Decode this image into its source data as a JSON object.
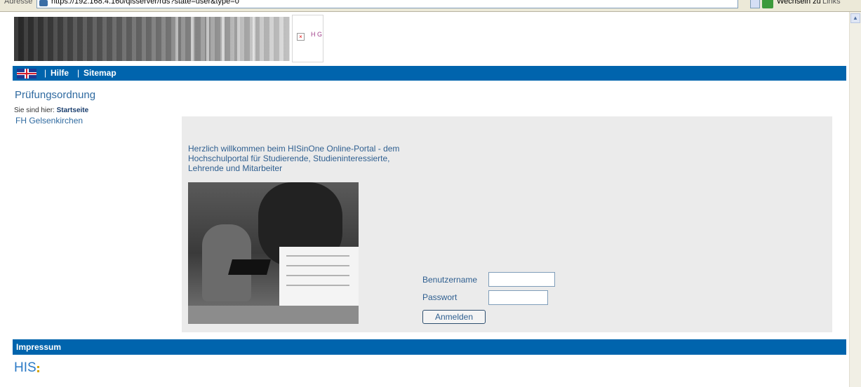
{
  "browser": {
    "address_label": "Adresse",
    "url": "https://192.168.4.160/qisserver/rds?state=user&type=0",
    "go_label": "Wechseln zu",
    "links_label": "Links"
  },
  "header": {
    "logo_alt": "H G",
    "nav": {
      "help_label": "Hilfe",
      "sitemap_label": "Sitemap",
      "separator": "|"
    }
  },
  "page": {
    "title": "Prüfungsordnung",
    "breadcrumb_prefix": "Sie sind hier:",
    "breadcrumb_current": "Startseite",
    "sidebar_org": "FH Gelsenkirchen"
  },
  "main": {
    "welcome_text": "Herzlich willkommen beim HISinOne Online-Portal - dem Hochschulportal für Studierende, Studieninteressierte, Lehrende und Mitarbeiter",
    "login": {
      "username_label": "Benutzername",
      "username_value": "",
      "password_label": "Passwort",
      "password_value": "",
      "submit_label": "Anmelden"
    }
  },
  "footer": {
    "impressum_label": "Impressum",
    "logo_text": "HIS"
  },
  "colors": {
    "bar_blue": "#0064ad",
    "text_blue": "#2f5f90",
    "content_gray": "#ebebeb"
  }
}
